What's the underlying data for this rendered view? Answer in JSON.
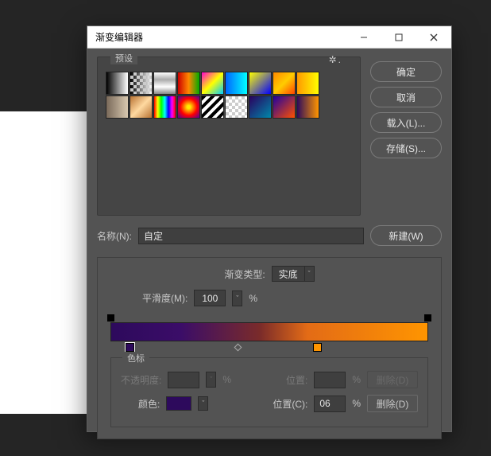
{
  "window": {
    "title": "渐变编辑器"
  },
  "presets": {
    "title": "预设",
    "swatches": [
      {
        "css": "linear-gradient(90deg,#000,#fff)"
      },
      {
        "css": "linear-gradient(90deg,#000,rgba(0,0,0,0));background-color:#fff;background-image:linear-gradient(45deg,#ccc 25%,transparent 25%,transparent 75%,#ccc 75%),linear-gradient(45deg,#ccc 25%,transparent 25%,transparent 75%,#ccc 75%),linear-gradient(90deg,#000,rgba(0,0,0,0));background-size:8px 8px,8px 8px,100% 100%;background-position:0 0,4px 4px,0 0"
      },
      {
        "css": "linear-gradient(180deg,#fff,#aaa,#fff,#888)"
      },
      {
        "css": "linear-gradient(90deg,#c00,#f80,#0a0)"
      },
      {
        "css": "linear-gradient(135deg,#f0c,#ff0,#0cf)"
      },
      {
        "css": "linear-gradient(90deg,#06f,#0ff)"
      },
      {
        "css": "linear-gradient(135deg,#ff0,#00f)"
      },
      {
        "css": "linear-gradient(135deg,#f80,#fc0,#f40)"
      },
      {
        "css": "linear-gradient(90deg,#f90,#ff0)"
      },
      {
        "css": "linear-gradient(90deg,#7a6a5a,#d8c8b0)"
      },
      {
        "css": "linear-gradient(135deg,#b87333,#ffd9a0,#b87333)"
      },
      {
        "css": "linear-gradient(90deg,#f00,#ff0,#0f0,#0ff,#00f,#f0f,#f00)"
      },
      {
        "css": "radial-gradient(circle,#ffeb00 10%,#ff0000 55%,#5000a0 100%)"
      },
      {
        "css": "repeating-linear-gradient(135deg,#000 0 4px,#fff 4px 8px)"
      },
      {
        "css": "#fff;background-image:linear-gradient(45deg,#ccc 25%,transparent 25%,transparent 75%,#ccc 75%),linear-gradient(45deg,#ccc 25%,transparent 25%,transparent 75%,#ccc 75%);background-size:8px 8px;background-position:0 0,4px 4px"
      },
      {
        "css": "linear-gradient(135deg,#2a005e,#0088aa)"
      },
      {
        "css": "linear-gradient(135deg,#2000a0,#ff5000)"
      },
      {
        "css": "linear-gradient(90deg,#2d0a5c,#ff9500)"
      }
    ]
  },
  "buttons": {
    "ok": "确定",
    "cancel": "取消",
    "load": "载入(L)...",
    "save": "存储(S)...",
    "new": "新建(W)",
    "delete": "删除(D)"
  },
  "name": {
    "label": "名称(N):",
    "value": "自定"
  },
  "type": {
    "label": "渐变类型:",
    "value": "实底"
  },
  "smoothness": {
    "label": "平滑度(M):",
    "value": "100",
    "unit": "%"
  },
  "gradient": {
    "css": "linear-gradient(90deg,#2d0a5c 0%,#3b0d68 22%,#7a2b2a 47%,#e36b16 62%,#ff9500 100%)",
    "color_stops": [
      {
        "pos": 6,
        "color": "#2d0a5c",
        "selected": true
      },
      {
        "pos": 65,
        "color": "#ff9500",
        "selected": false
      }
    ],
    "midpoints": [
      {
        "pos": 40
      }
    ]
  },
  "stops": {
    "title": "色标",
    "opacity": {
      "label": "不透明度:",
      "value": "",
      "unit": "%",
      "pos_label": "位置:",
      "pos_value": "",
      "enabled": false
    },
    "color": {
      "label": "颜色:",
      "chip": "#2d0a5c",
      "pos_label": "位置(C):",
      "pos_value": "06",
      "unit": "%",
      "enabled": true
    }
  }
}
